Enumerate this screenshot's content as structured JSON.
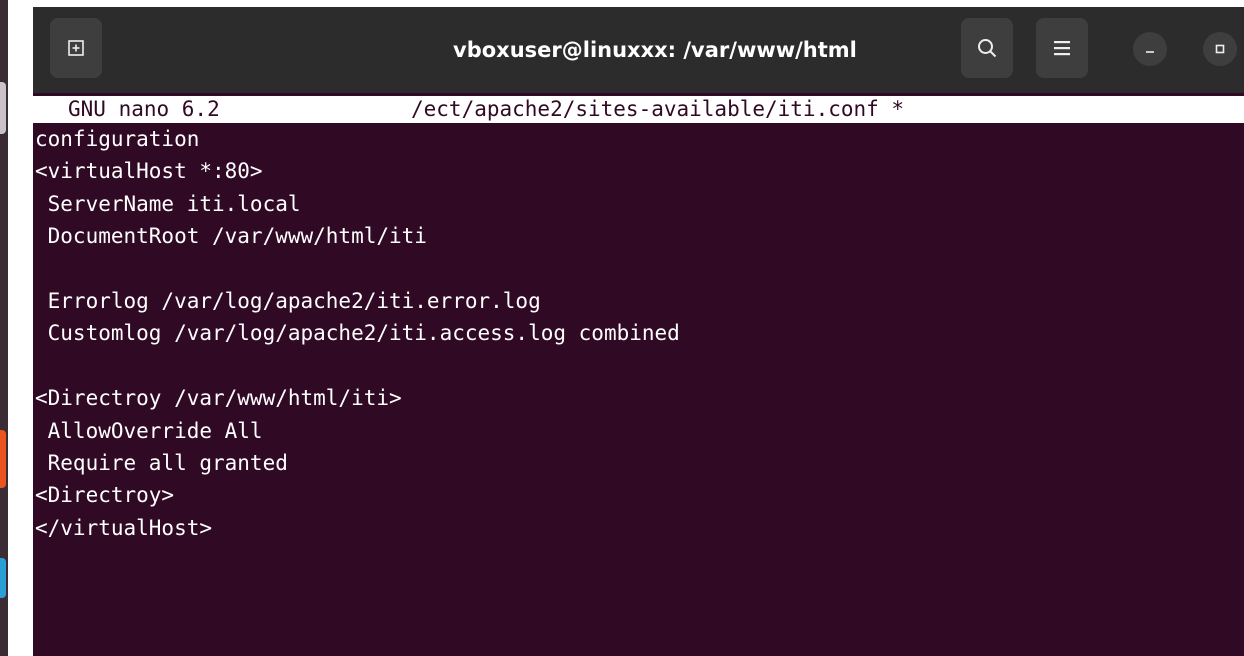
{
  "window": {
    "title": "vboxuser@linuxxx: /var/www/html"
  },
  "titlebar_buttons": {
    "new_tab_icon": "new-tab-icon",
    "search_icon": "search-icon",
    "menu_icon": "hamburger-menu-icon",
    "minimize_icon": "minimize-icon",
    "maximize_icon": "maximize-icon"
  },
  "nano": {
    "version": "GNU nano 6.2",
    "filename": "/ect/apache2/sites-available/iti.conf *"
  },
  "editor_lines": [
    "configuration",
    "<virtualHost *:80>",
    " ServerName iti.local",
    " DocumentRoot /var/www/html/iti",
    "",
    " Errorlog /var/log/apache2/iti.error.log",
    " Customlog /var/log/apache2/iti.access.log combined",
    "",
    "<Directroy /var/www/html/iti>",
    " AllowOverride All",
    " Require all granted",
    "<Directroy>",
    "</virtualHost>"
  ],
  "colors": {
    "terminal_bg": "#300a24",
    "titlebar_bg": "#2c2c2c",
    "accent_orange": "#e9541f"
  }
}
